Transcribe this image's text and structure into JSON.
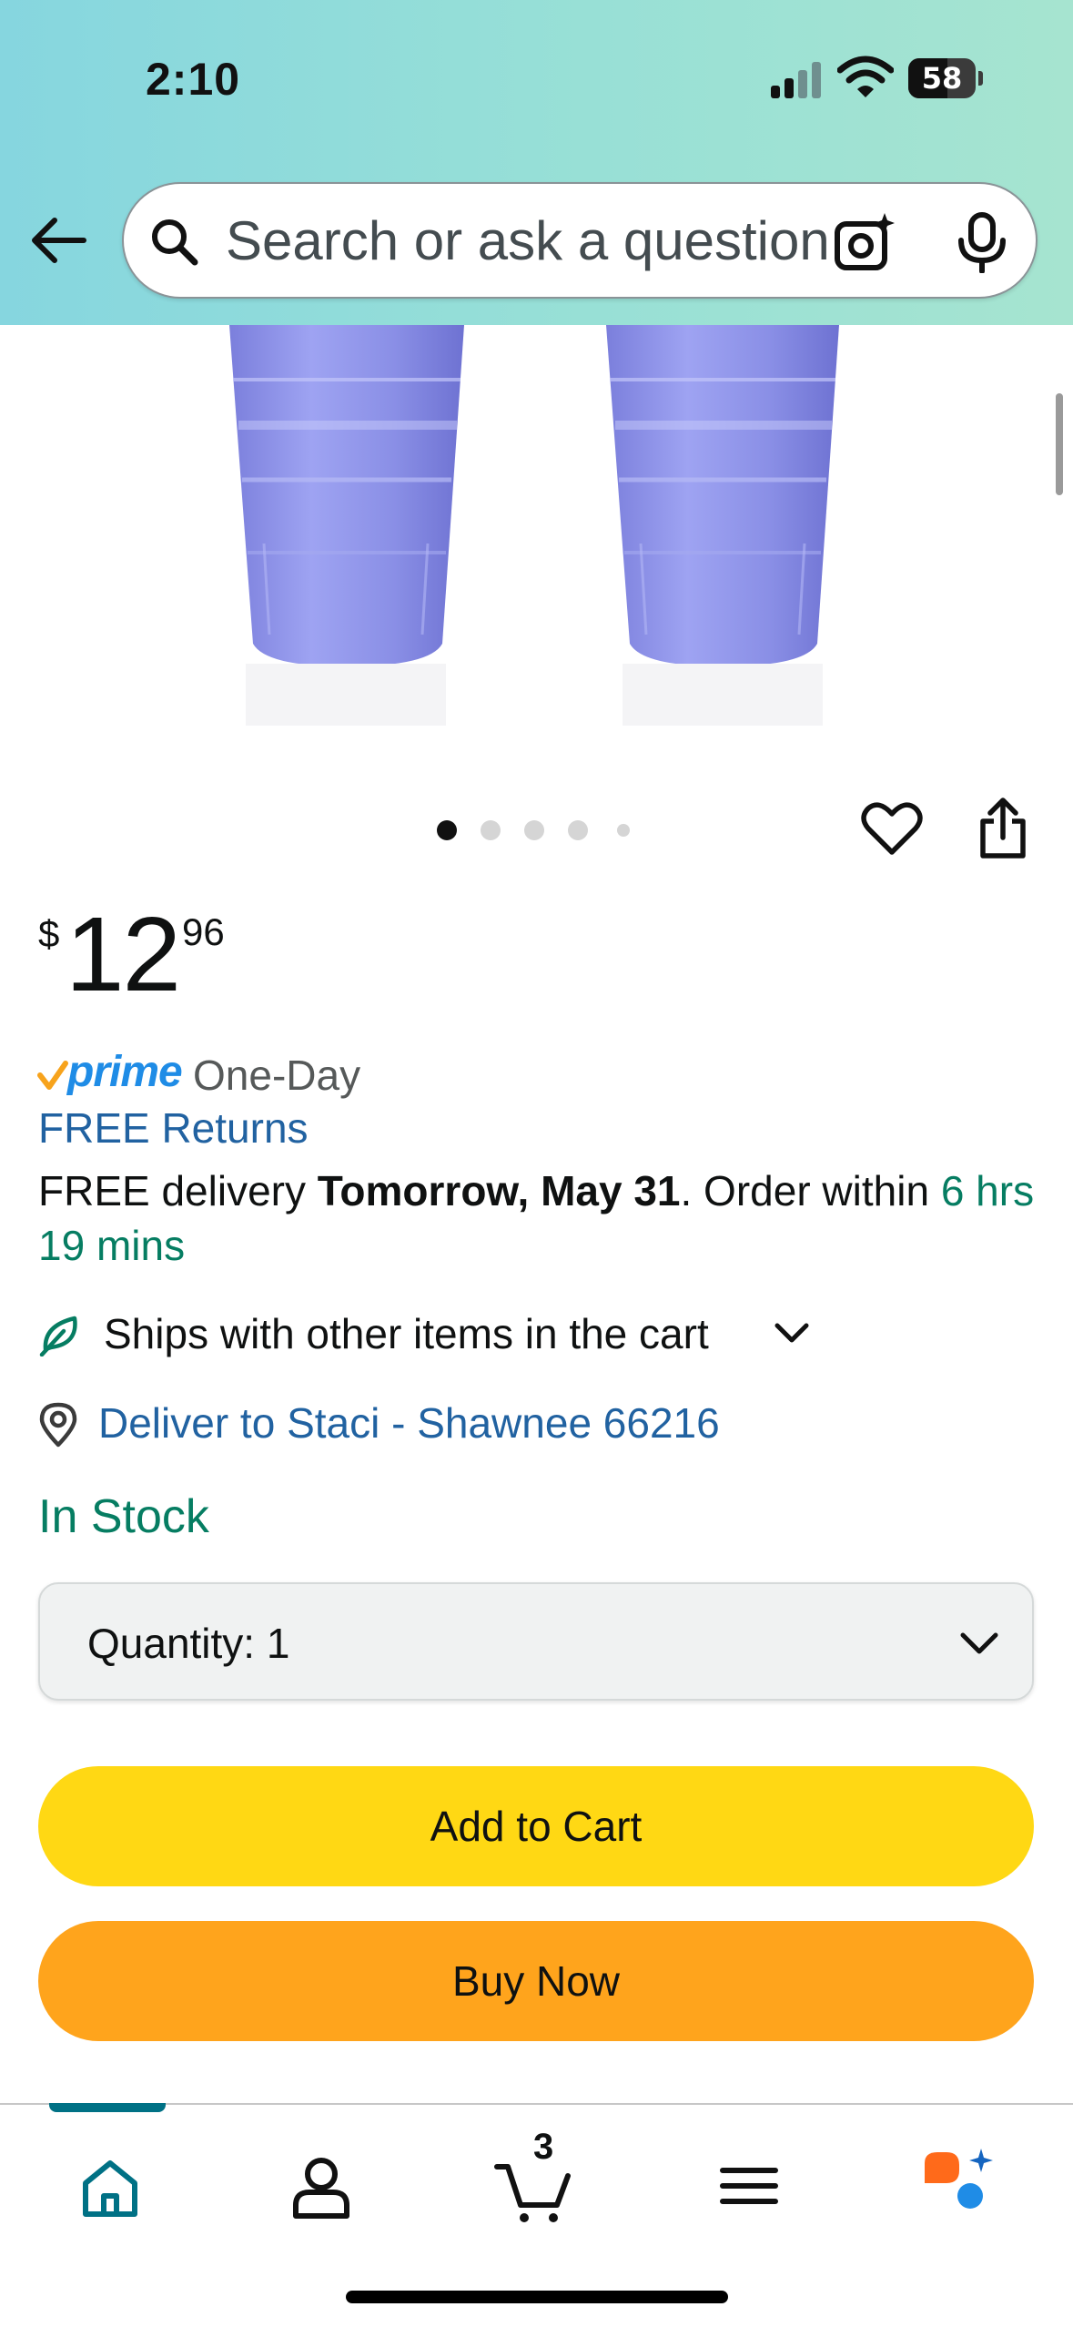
{
  "status_bar": {
    "time": "2:10",
    "battery_percent": 58,
    "battery_label": "58"
  },
  "header": {
    "search_placeholder": "Search or ask a question"
  },
  "product": {
    "image_count": 5,
    "active_image": 1,
    "price": {
      "symbol": "$",
      "whole": "12",
      "fraction": "96"
    },
    "prime_label": "prime",
    "prime_speed": "One-Day",
    "returns": "FREE Returns",
    "delivery": {
      "prefix": "FREE delivery ",
      "date": "Tomorrow, May 31",
      "middle": ". Order within ",
      "countdown": "6 hrs 19 mins"
    },
    "ships_note": "Ships with other items in the cart",
    "deliver_to": "Deliver to Staci - Shawnee 66216",
    "stock": "In Stock",
    "quantity_label": "Quantity:",
    "quantity_value": "1",
    "add_to_cart": "Add to Cart",
    "buy_now": "Buy Now"
  },
  "tabbar": {
    "cart_count": "3",
    "active_tab": "home"
  },
  "colors": {
    "prime_blue": "#1f8ce6",
    "prime_check": "#f7a31c",
    "link": "#2162a1",
    "stock_green": "#067d62",
    "add_to_cart": "#ffd814",
    "buy_now": "#ffa41c",
    "active_tab": "#007185"
  },
  "icons": [
    "back-arrow-icon",
    "search-icon",
    "camera-lens-icon",
    "microphone-icon",
    "heart-icon",
    "share-icon",
    "leaf-icon",
    "location-pin-icon",
    "chevron-down-icon",
    "home-icon",
    "account-icon",
    "cart-icon",
    "menu-icon",
    "rufus-ai-icon"
  ]
}
